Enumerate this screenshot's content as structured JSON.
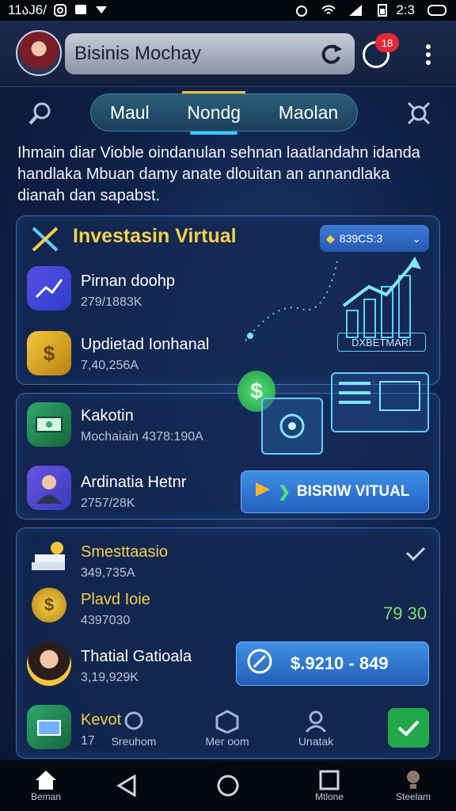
{
  "status_bar": {
    "time_left": "11აJ6/",
    "time_right": "2:3"
  },
  "header": {
    "app_name": "Bisinis Mochay",
    "notif_count": "18"
  },
  "tabs": [
    {
      "label": "Maul"
    },
    {
      "label": "Nondg"
    },
    {
      "label": "Maolan"
    }
  ],
  "intro_text": "Ihmain diar Vioble oindanulan sehnan laatlandahn idanda handlaka Mbuan damy anate dlouitan an annandlaka dianah dan sapabst.",
  "investasi": {
    "title": "Investasin Virtual",
    "dropdown_label": "839CS:3",
    "chart_label": "DXBETMARI",
    "rows": [
      {
        "title": "Pirnan doohp",
        "sub": "279/1883K"
      },
      {
        "title": "Updietad Ionhanal",
        "sub": "7,40,256A"
      }
    ]
  },
  "mid_rows": [
    {
      "title": "Kakotin",
      "sub": "Mochaiain 4378:190A"
    },
    {
      "title": "Ardinatia Hetnr",
      "sub": "2757/28K"
    }
  ],
  "cta_label": "BISRIW VITUAL",
  "bottom_card": {
    "rows": [
      {
        "title": "Smesttaasio",
        "sub": "349,735A"
      },
      {
        "title": "Plavd Ioie",
        "sub": "4397030"
      },
      {
        "title": "Thatial Gatioala",
        "sub": "3,19,929K"
      },
      {
        "title": "Kevot",
        "sub": "17"
      }
    ],
    "green_value": "79 30",
    "amount_label": "$.9210 - 849"
  },
  "mini_nav": [
    {
      "label": "Sreuhom"
    },
    {
      "label": "Mer oom"
    },
    {
      "label": "Unatak"
    }
  ],
  "bottom_nav": [
    {
      "label": "Beman"
    },
    {
      "label": ""
    },
    {
      "label": ""
    },
    {
      "label": "Mtlone"
    },
    {
      "label": "Steelam"
    }
  ]
}
